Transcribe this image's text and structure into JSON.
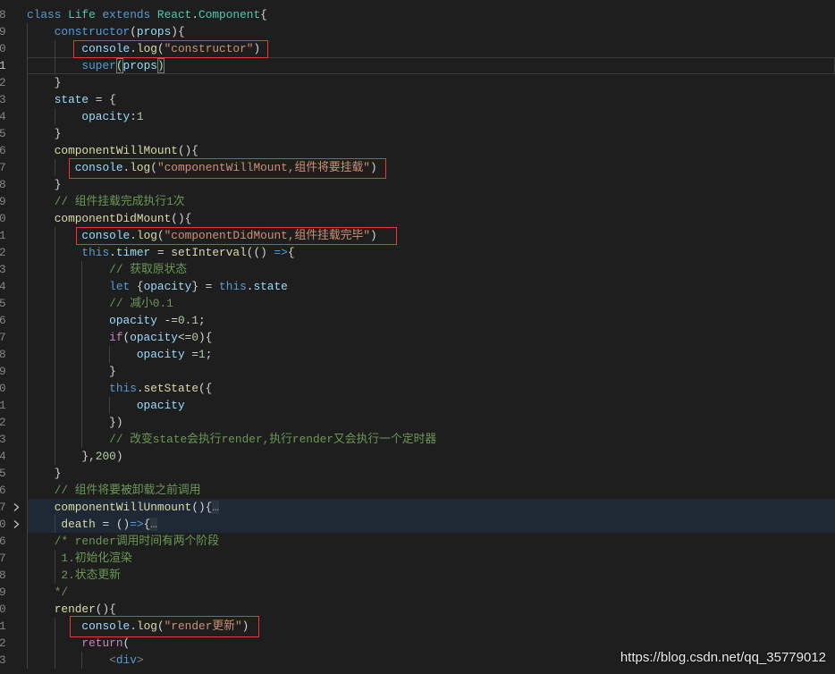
{
  "editor": {
    "theme": {
      "background": "#1e1e1e",
      "annotation_color": "#e53935"
    },
    "lines": [
      {
        "num": "8",
        "tokens": [
          [
            "#569cd6",
            "class "
          ],
          [
            "#4ec9b0",
            "Life "
          ],
          [
            "#569cd6",
            "extends "
          ],
          [
            "#4ec9b0",
            "React"
          ],
          [
            "#d4d4d4",
            "."
          ],
          [
            "#4ec9b0",
            "Component"
          ],
          [
            "#d4d4d4",
            "{"
          ]
        ]
      },
      {
        "num": "9",
        "tokens": [
          [
            "#569cd6",
            "    constructor"
          ],
          [
            "#d4d4d4",
            "("
          ],
          [
            "#9cdcfe",
            "props"
          ],
          [
            "#d4d4d4",
            "){"
          ]
        ]
      },
      {
        "num": "0",
        "tokens": [
          [
            "#9cdcfe",
            "        console"
          ],
          [
            "#d4d4d4",
            "."
          ],
          [
            "#dcdcaa",
            "log"
          ],
          [
            "#d4d4d4",
            "("
          ],
          [
            "#ce9178",
            "\"constructor\""
          ],
          [
            "#d4d4d4",
            ")"
          ]
        ]
      },
      {
        "num": "1",
        "current": true,
        "tokens": [
          [
            "#569cd6",
            "        super"
          ],
          [
            "#d4d4d4",
            "("
          ],
          [
            "#9cdcfe",
            "props"
          ],
          [
            "#d4d4d4",
            ")"
          ]
        ]
      },
      {
        "num": "2",
        "tokens": [
          [
            "#d4d4d4",
            "    }"
          ]
        ]
      },
      {
        "num": "3",
        "tokens": [
          [
            "#9cdcfe",
            "    state"
          ],
          [
            "#d4d4d4",
            " = {"
          ]
        ]
      },
      {
        "num": "4",
        "tokens": [
          [
            "#9cdcfe",
            "        opacity"
          ],
          [
            "#d4d4d4",
            ":"
          ],
          [
            "#b5cea8",
            "1"
          ]
        ]
      },
      {
        "num": "5",
        "tokens": [
          [
            "#d4d4d4",
            "    }"
          ]
        ]
      },
      {
        "num": "6",
        "tokens": [
          [
            "#dcdcaa",
            "    componentWillMount"
          ],
          [
            "#d4d4d4",
            "(){"
          ]
        ]
      },
      {
        "num": "7",
        "tokens": [
          [
            "#9cdcfe",
            "       console"
          ],
          [
            "#d4d4d4",
            "."
          ],
          [
            "#dcdcaa",
            "log"
          ],
          [
            "#d4d4d4",
            "("
          ],
          [
            "#ce9178",
            "\"componentWillMount,组件将要挂载\""
          ],
          [
            "#d4d4d4",
            ")"
          ]
        ]
      },
      {
        "num": "8",
        "tokens": [
          [
            "#d4d4d4",
            "    }"
          ]
        ]
      },
      {
        "num": "9",
        "tokens": [
          [
            "#6a9955",
            "    // 组件挂载完成执行1次"
          ]
        ]
      },
      {
        "num": "0",
        "tokens": [
          [
            "#dcdcaa",
            "    componentDidMount"
          ],
          [
            "#d4d4d4",
            "(){"
          ]
        ]
      },
      {
        "num": "1",
        "tokens": [
          [
            "#9cdcfe",
            "        console"
          ],
          [
            "#d4d4d4",
            "."
          ],
          [
            "#dcdcaa",
            "log"
          ],
          [
            "#d4d4d4",
            "("
          ],
          [
            "#ce9178",
            "\"componentDidMount,组件挂载完毕\""
          ],
          [
            "#d4d4d4",
            ")"
          ]
        ]
      },
      {
        "num": "2",
        "tokens": [
          [
            "#569cd6",
            "        this"
          ],
          [
            "#d4d4d4",
            "."
          ],
          [
            "#9cdcfe",
            "timer"
          ],
          [
            "#d4d4d4",
            " = "
          ],
          [
            "#dcdcaa",
            "setInterval"
          ],
          [
            "#d4d4d4",
            "(() "
          ],
          [
            "#569cd6",
            "=>"
          ],
          [
            "#d4d4d4",
            "{"
          ]
        ]
      },
      {
        "num": "3",
        "tokens": [
          [
            "#6a9955",
            "            // 获取原状态"
          ]
        ]
      },
      {
        "num": "4",
        "tokens": [
          [
            "#569cd6",
            "            let "
          ],
          [
            "#d4d4d4",
            "{"
          ],
          [
            "#9cdcfe",
            "opacity"
          ],
          [
            "#d4d4d4",
            "} = "
          ],
          [
            "#569cd6",
            "this"
          ],
          [
            "#d4d4d4",
            "."
          ],
          [
            "#9cdcfe",
            "state"
          ]
        ]
      },
      {
        "num": "5",
        "tokens": [
          [
            "#6a9955",
            "            // 减小0.1"
          ]
        ]
      },
      {
        "num": "6",
        "tokens": [
          [
            "#9cdcfe",
            "            opacity"
          ],
          [
            "#d4d4d4",
            " -="
          ],
          [
            "#b5cea8",
            "0.1"
          ],
          [
            "#d4d4d4",
            ";"
          ]
        ]
      },
      {
        "num": "7",
        "tokens": [
          [
            "#c586c0",
            "            if"
          ],
          [
            "#d4d4d4",
            "("
          ],
          [
            "#9cdcfe",
            "opacity"
          ],
          [
            "#d4d4d4",
            "<="
          ],
          [
            "#b5cea8",
            "0"
          ],
          [
            "#d4d4d4",
            "){"
          ]
        ]
      },
      {
        "num": "8",
        "tokens": [
          [
            "#9cdcfe",
            "                opacity"
          ],
          [
            "#d4d4d4",
            " ="
          ],
          [
            "#b5cea8",
            "1"
          ],
          [
            "#d4d4d4",
            ";"
          ]
        ]
      },
      {
        "num": "9",
        "tokens": [
          [
            "#d4d4d4",
            "            }"
          ]
        ]
      },
      {
        "num": "0",
        "tokens": [
          [
            "#569cd6",
            "            this"
          ],
          [
            "#d4d4d4",
            "."
          ],
          [
            "#dcdcaa",
            "setState"
          ],
          [
            "#d4d4d4",
            "({"
          ]
        ]
      },
      {
        "num": "1",
        "tokens": [
          [
            "#9cdcfe",
            "                opacity"
          ]
        ]
      },
      {
        "num": "2",
        "tokens": [
          [
            "#d4d4d4",
            "            })"
          ]
        ]
      },
      {
        "num": "3",
        "tokens": [
          [
            "#6a9955",
            "            // 改变state会执行render,执行render又会执行一个定时器"
          ]
        ]
      },
      {
        "num": "4",
        "tokens": [
          [
            "#d4d4d4",
            "        },"
          ],
          [
            "#b5cea8",
            "200"
          ],
          [
            "#d4d4d4",
            ")"
          ]
        ]
      },
      {
        "num": "5",
        "tokens": [
          [
            "#d4d4d4",
            "    }"
          ]
        ]
      },
      {
        "num": "6",
        "tokens": [
          [
            "#6a9955",
            "    // 组件将要被卸载之前调用"
          ]
        ]
      },
      {
        "num": "7",
        "folded": true,
        "tokens": [
          [
            "#dcdcaa",
            "    componentWillUnmount"
          ],
          [
            "#d4d4d4",
            "(){"
          ],
          [
            "#a0a0a0",
            "…"
          ]
        ]
      },
      {
        "num": "0",
        "folded": true,
        "tokens": [
          [
            "#dcdcaa",
            "     death"
          ],
          [
            "#d4d4d4",
            " = ()"
          ],
          [
            "#569cd6",
            "=>"
          ],
          [
            "#d4d4d4",
            "{"
          ],
          [
            "#a0a0a0",
            "…"
          ]
        ]
      },
      {
        "num": "6",
        "tokens": [
          [
            "#6a9955",
            "    /* render调用时间有两个阶段"
          ]
        ]
      },
      {
        "num": "7",
        "tokens": [
          [
            "#6a9955",
            "     1.初始化渲染"
          ]
        ]
      },
      {
        "num": "8",
        "tokens": [
          [
            "#6a9955",
            "     2.状态更新"
          ]
        ]
      },
      {
        "num": "9",
        "tokens": [
          [
            "#6a9955",
            "    */"
          ]
        ]
      },
      {
        "num": "0",
        "tokens": [
          [
            "#dcdcaa",
            "    render"
          ],
          [
            "#d4d4d4",
            "(){"
          ]
        ]
      },
      {
        "num": "1",
        "tokens": [
          [
            "#9cdcfe",
            "        console"
          ],
          [
            "#d4d4d4",
            "."
          ],
          [
            "#dcdcaa",
            "log"
          ],
          [
            "#d4d4d4",
            "("
          ],
          [
            "#ce9178",
            "\"render更新\""
          ],
          [
            "#d4d4d4",
            ")"
          ]
        ]
      },
      {
        "num": "2",
        "tokens": [
          [
            "#c586c0",
            "        return"
          ],
          [
            "#d4d4d4",
            "("
          ]
        ]
      },
      {
        "num": "3",
        "tokens": [
          [
            "#808080",
            "            <"
          ],
          [
            "#569cd6",
            "div"
          ],
          [
            "#808080",
            ">"
          ]
        ]
      }
    ]
  },
  "watermark": {
    "text": "https://blog.csdn.net/qq_35779012"
  }
}
